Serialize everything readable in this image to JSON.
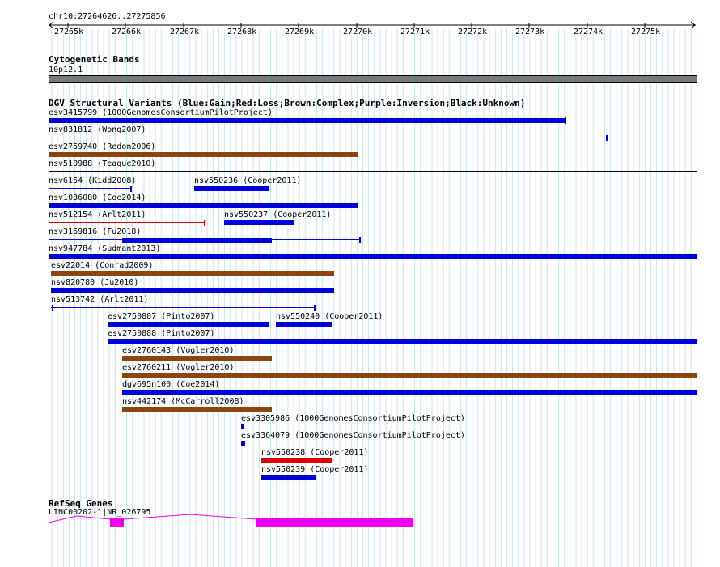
{
  "ruler": {
    "coords": "chr10:27264626..27275856",
    "ticks": [
      "27265k",
      "27266k",
      "27267k",
      "27268k",
      "27269k",
      "27270k",
      "27271k",
      "27272k",
      "27273k",
      "27274k",
      "27275k"
    ]
  },
  "cytoband": {
    "title": "Cytogenetic Bands",
    "band": "10p12.1"
  },
  "dgv": {
    "title": "DGV Structural Variants (Blue:Gain;Red:Loss;Brown:Complex;Purple:Inversion;Black:Unknown)",
    "colors": {
      "gain": "#0000dd",
      "loss": "#dd0000",
      "complex": "#8b4513",
      "unknown": "#000000"
    },
    "items": [
      {
        "label": "esv3415799 (1000GenomesConsortiumPilotProject)",
        "type": "gain",
        "style": "bar"
      },
      {
        "label": "nsv831812 (Wong2007)",
        "type": "gain",
        "style": "line"
      },
      {
        "label": "esv2759740 (Redon2006)",
        "type": "complex",
        "style": "bar"
      },
      {
        "label": "nsv510988 (Teague2010)",
        "type": "unknown",
        "style": "none"
      },
      {
        "label": "nsv6154 (Kidd2008)",
        "type": "gain",
        "style": "line"
      },
      {
        "label": "nsv550236 (Cooper2011)",
        "type": "gain",
        "style": "bar"
      },
      {
        "label": "nsv1036080 (Coe2014)",
        "type": "gain",
        "style": "bar"
      },
      {
        "label": "nsv512154 (Arlt2011)",
        "type": "loss",
        "style": "line"
      },
      {
        "label": "nsv550237 (Cooper2011)",
        "type": "gain",
        "style": "bar"
      },
      {
        "label": "nsv3169816 (Fu2018)",
        "type": "gain",
        "style": "mixed"
      },
      {
        "label": "nsv947784 (Sudmant2013)",
        "type": "gain",
        "style": "bar"
      },
      {
        "label": "esv22014 (Conrad2009)",
        "type": "complex",
        "style": "bar"
      },
      {
        "label": "nsv820780 (Ju2010)",
        "type": "gain",
        "style": "bar"
      },
      {
        "label": "nsv513742 (Arlt2011)",
        "type": "gain",
        "style": "line"
      },
      {
        "label": "esv2750887 (Pinto2007)",
        "type": "gain",
        "style": "bar"
      },
      {
        "label": "nsv550240 (Cooper2011)",
        "type": "gain",
        "style": "bar"
      },
      {
        "label": "esv2750888 (Pinto2007)",
        "type": "gain",
        "style": "bar"
      },
      {
        "label": "esv2760143 (Vogler2010)",
        "type": "complex",
        "style": "bar"
      },
      {
        "label": "esv2760211 (Vogler2010)",
        "type": "complex",
        "style": "bar"
      },
      {
        "label": "dgv695n100 (Coe2014)",
        "type": "gain",
        "style": "bar"
      },
      {
        "label": "nsv442174 (McCarroll2008)",
        "type": "complex",
        "style": "bar"
      },
      {
        "label": "esv3305986 (1000GenomesConsortiumPilotProject)",
        "type": "gain",
        "style": "bar"
      },
      {
        "label": "esv3364079 (1000GenomesConsortiumPilotProject)",
        "type": "gain",
        "style": "bar"
      },
      {
        "label": "nsv550238 (Cooper2011)",
        "type": "loss",
        "style": "bar"
      },
      {
        "label": "nsv550239 (Cooper2011)",
        "type": "gain",
        "style": "bar"
      }
    ]
  },
  "refseq": {
    "title": "RefSeq Genes",
    "gene": "LINC00202-1|NR_026795",
    "color": "#ee00ee"
  }
}
